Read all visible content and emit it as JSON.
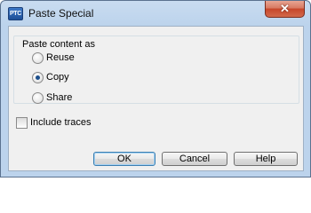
{
  "window": {
    "title": "Paste Special",
    "app_icon_text": "PTC",
    "close_glyph": "✕"
  },
  "group": {
    "label": "Paste content as",
    "options": [
      {
        "label": "Reuse",
        "checked": false
      },
      {
        "label": "Copy",
        "checked": true
      },
      {
        "label": "Share",
        "checked": false
      }
    ]
  },
  "include_traces": {
    "label": "Include traces",
    "checked": false
  },
  "buttons": {
    "ok": "OK",
    "cancel": "Cancel",
    "help": "Help"
  },
  "icons": {
    "app": "ptc-app-icon",
    "close": "close-icon"
  }
}
